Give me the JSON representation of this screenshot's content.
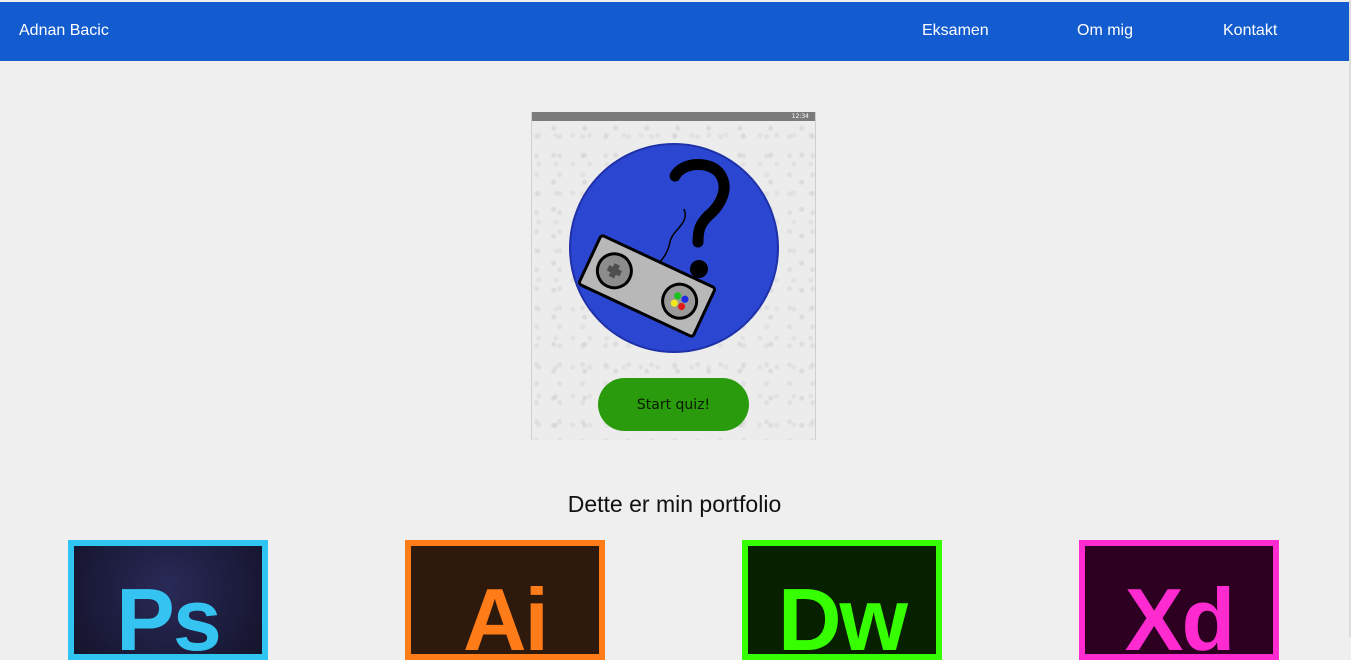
{
  "header": {
    "brand": "Adnan Bacic",
    "nav": [
      "Eksamen",
      "Om mig",
      "Kontakt"
    ],
    "bg_color": "#135ccf"
  },
  "hero": {
    "start_button_label": "Start quiz!",
    "status_bar_text": "12:34",
    "logo_circle_color": "#2b46d1",
    "button_color": "#2a9b0c"
  },
  "portfolio": {
    "title": "Dette er min portfolio",
    "tools": [
      {
        "abbr": "Ps",
        "border_color": "#2ec6f0",
        "text_color": "#35c3f1",
        "bg_color": "#1c1c3d"
      },
      {
        "abbr": "Ai",
        "border_color": "#ff7c19",
        "text_color": "#ff7c19",
        "bg_color": "#2e1a0c"
      },
      {
        "abbr": "Dw",
        "border_color": "#35ff00",
        "text_color": "#35ff00",
        "bg_color": "#062000"
      },
      {
        "abbr": "Xd",
        "border_color": "#ff2bd0",
        "text_color": "#ff2bd0",
        "bg_color": "#2d0022"
      }
    ]
  }
}
